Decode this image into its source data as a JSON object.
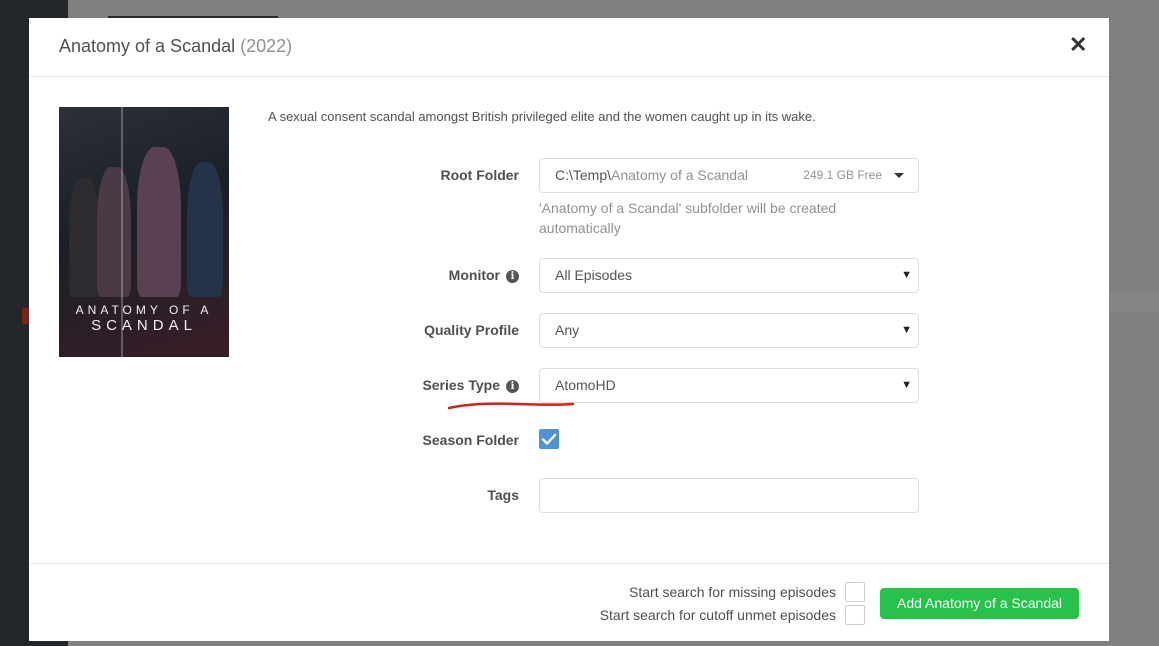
{
  "modal": {
    "title": "Anatomy of a Scandal",
    "year": "(2022)",
    "close_glyph": "✕"
  },
  "poster": {
    "title_small": "ANATOMY OF A",
    "title_big": "SCANDAL"
  },
  "overview": "A sexual consent scandal amongst British privileged elite and the women caught up in its wake.",
  "form": {
    "root_folder": {
      "label": "Root Folder",
      "path_root": "C:\\Temp\\",
      "path_sub": "Anatomy of a Scandal",
      "free_space": "249.1 GB Free",
      "help": "'Anatomy of a Scandal' subfolder will be created automatically"
    },
    "monitor": {
      "label": "Monitor",
      "value": "All Episodes"
    },
    "quality_profile": {
      "label": "Quality Profile",
      "value": "Any"
    },
    "series_type": {
      "label": "Series Type",
      "value": "AtomoHD"
    },
    "season_folder": {
      "label": "Season Folder",
      "checked": true
    },
    "tags": {
      "label": "Tags",
      "value": ""
    }
  },
  "footer": {
    "search_missing_label": "Start search for missing episodes",
    "search_cutoff_label": "Start search for cutoff unmet episodes",
    "add_button_label": "Add Anatomy of a Scandal"
  },
  "colors": {
    "accent_blue": "#4f92d5",
    "success_green": "#27c24c",
    "annotation_red": "#d42020"
  },
  "icons": {
    "info": "info-icon",
    "close": "close-icon",
    "chevron": "chevron-down-icon",
    "check": "checkmark-icon"
  }
}
